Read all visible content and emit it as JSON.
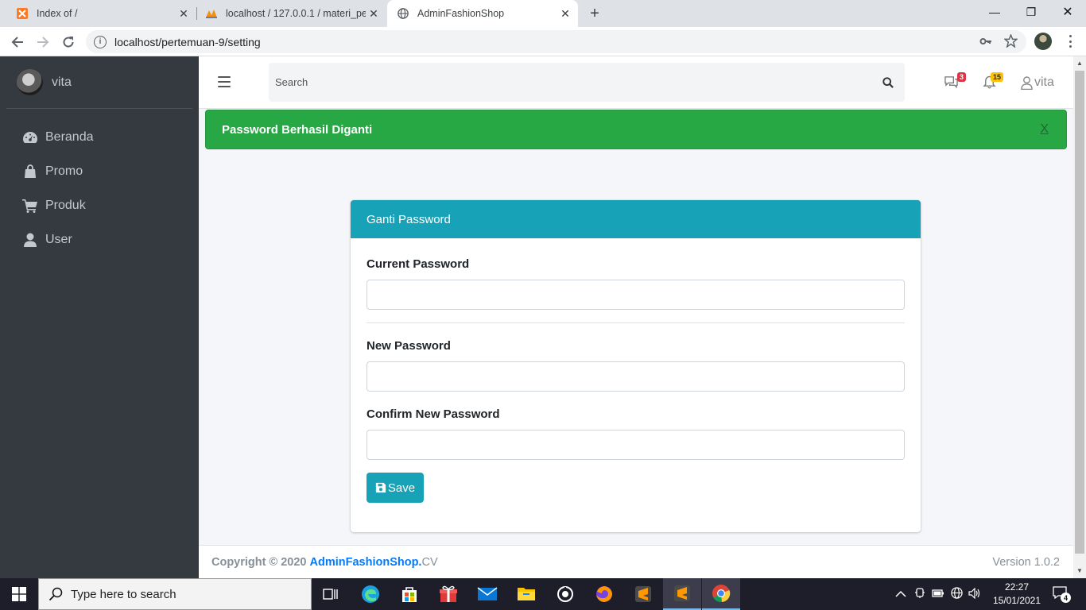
{
  "browser": {
    "tabs": [
      {
        "title": "Index of /",
        "icon": "xampp-icon",
        "active": false
      },
      {
        "title": "localhost / 127.0.0.1 / materi_pem",
        "icon": "phpmyadmin-icon",
        "active": false
      },
      {
        "title": "AdminFashionShop",
        "icon": "globe-icon",
        "active": true
      }
    ],
    "url": "localhost/pertemuan-9/setting"
  },
  "sidebar": {
    "user_name": "vita",
    "items": [
      {
        "label": "Beranda",
        "icon": "tachometer-icon"
      },
      {
        "label": "Promo",
        "icon": "shopping-bag-icon"
      },
      {
        "label": "Produk",
        "icon": "shopping-cart-icon"
      },
      {
        "label": "User",
        "icon": "user-icon"
      }
    ]
  },
  "topnav": {
    "search_placeholder": "Search",
    "messages_count": "3",
    "notifications_count": "15",
    "user_name": "vita",
    "colors": {
      "messages_badge": "#dc3545",
      "notifications_badge": "#ffc107"
    }
  },
  "alert": {
    "message": "Password Berhasil Diganti",
    "close_label": "X",
    "color": "#28a745"
  },
  "card": {
    "title": "Ganti Password",
    "header_color": "#17a2b8",
    "fields": {
      "current_password_label": "Current Password",
      "new_password_label": "New Password",
      "confirm_password_label": "Confirm New Password"
    },
    "save_label": "Save"
  },
  "footer": {
    "copyright_prefix": "Copyright © 2020",
    "brand": "AdminFashionShop.",
    "suffix": "CV",
    "version": "Version 1.0.2"
  },
  "taskbar": {
    "search_placeholder": "Type here to search",
    "time": "22:27",
    "date": "15/01/2021",
    "notification_count": "4"
  }
}
